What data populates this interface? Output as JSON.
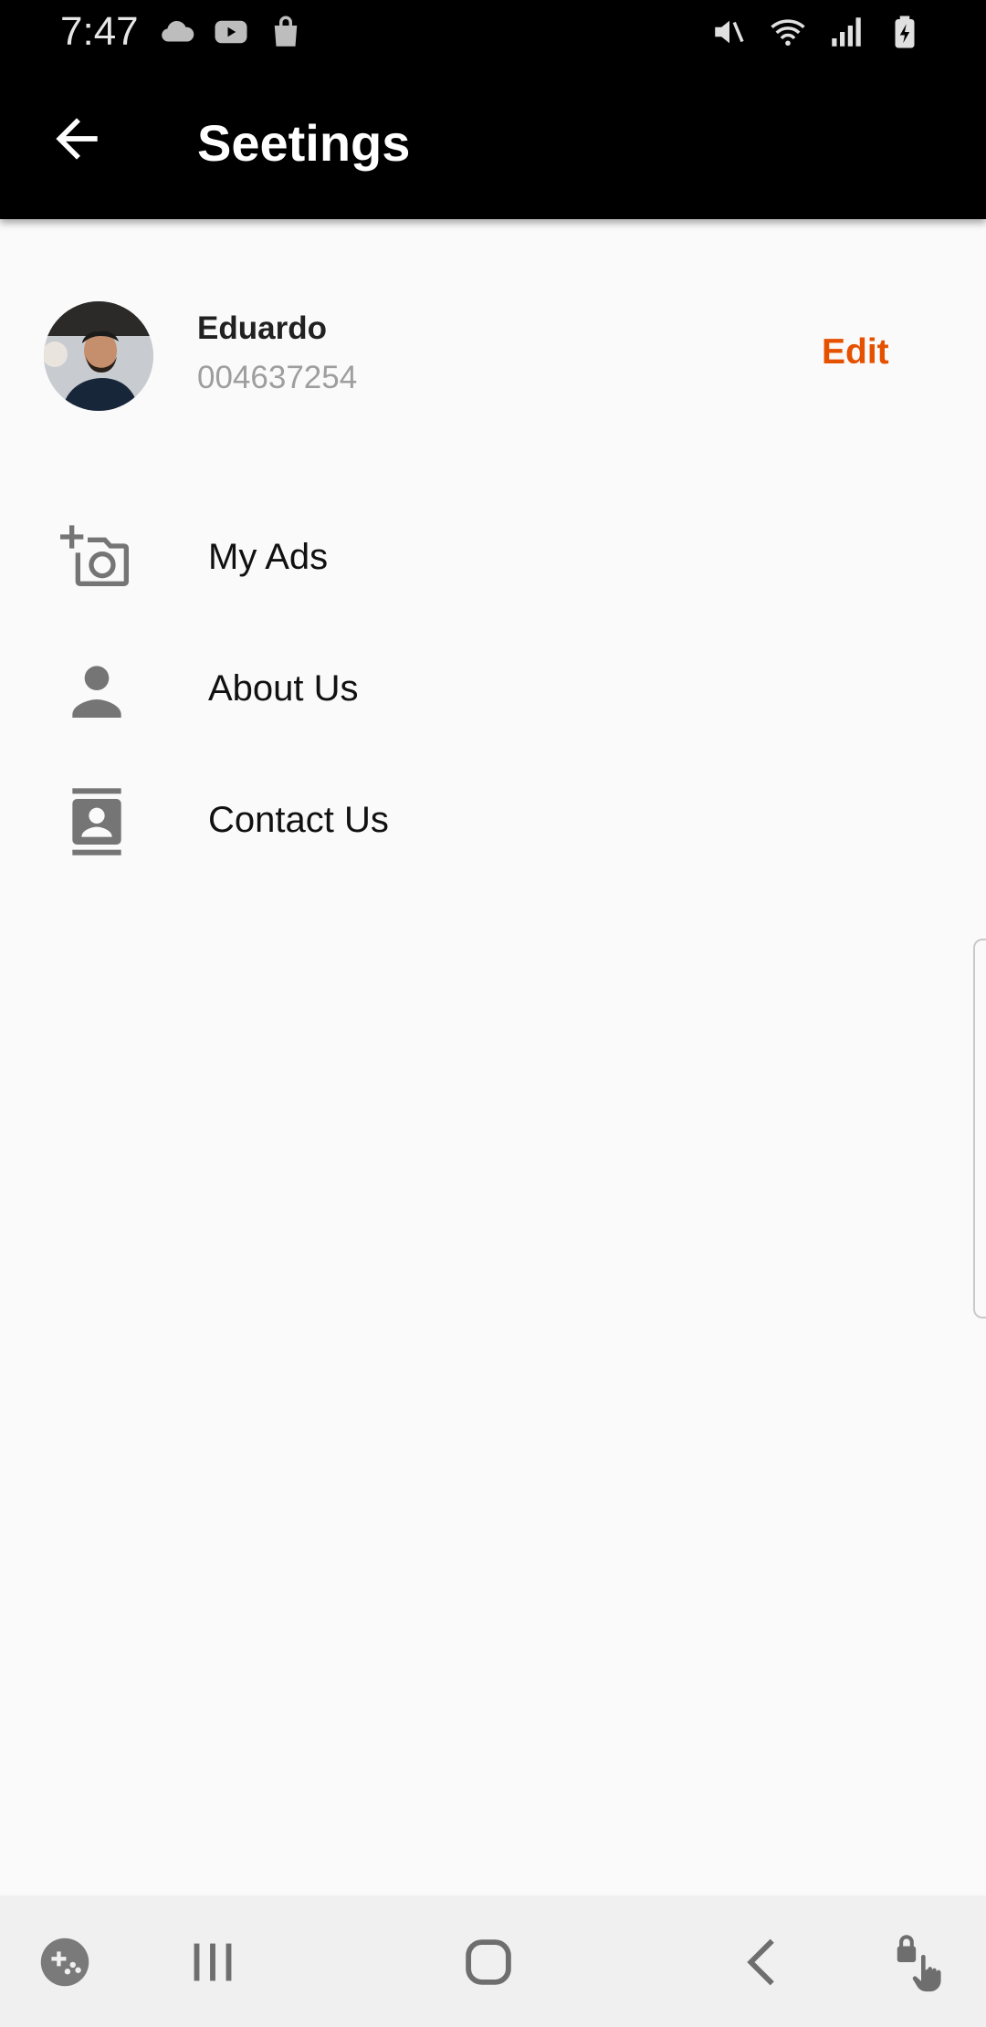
{
  "status_bar": {
    "time": "7:47",
    "left_icons": [
      "cloud-icon",
      "youtube-icon",
      "shopping-bag-icon"
    ],
    "right_icons": [
      "mute-icon",
      "wifi-icon",
      "signal-icon",
      "battery-charging-icon"
    ]
  },
  "app_bar": {
    "title": "Seetings",
    "back_icon": "arrow-left-icon"
  },
  "profile": {
    "name": "Eduardo",
    "phone": "004637254",
    "edit_label": "Edit",
    "accent_color": "#e65100"
  },
  "menu": {
    "items": [
      {
        "label": "My Ads",
        "icon": "add-camera-icon"
      },
      {
        "label": "About Us",
        "icon": "person-icon"
      },
      {
        "label": "Contact Us",
        "icon": "contact-card-icon"
      }
    ]
  },
  "nav_bar": {
    "buttons": [
      "game-launcher-icon",
      "recent-apps-icon",
      "home-icon",
      "back-icon",
      "touch-lock-icon"
    ]
  }
}
